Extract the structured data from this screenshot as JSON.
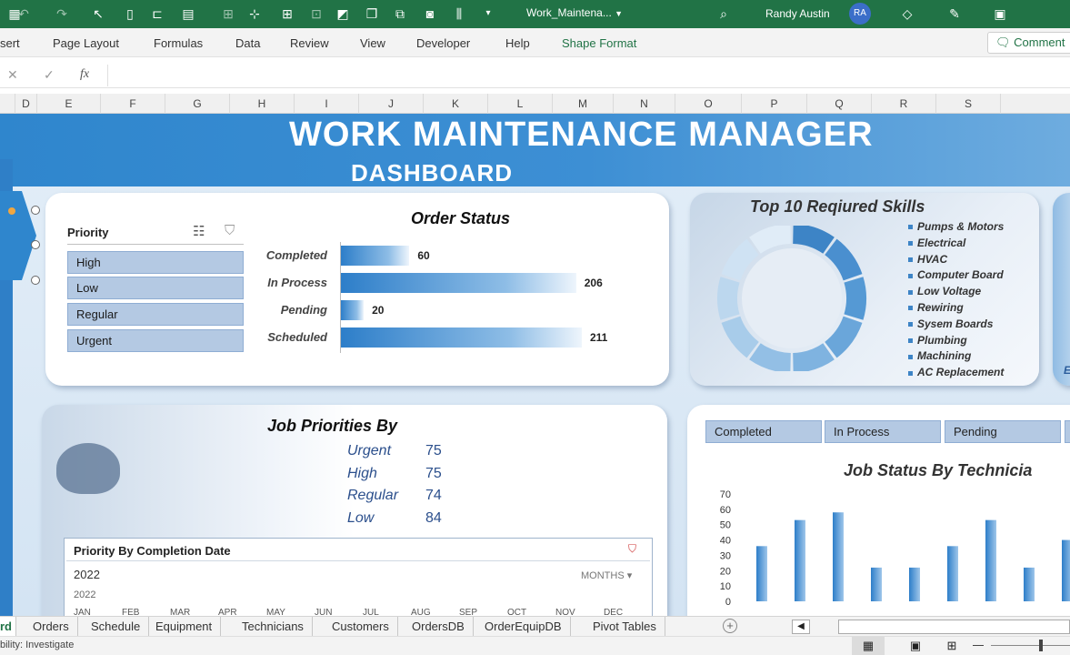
{
  "titlebar": {
    "filename": "Work_Maintena...",
    "user": "Randy Austin",
    "user_initials": "RA"
  },
  "ribbon": {
    "tabs": [
      "sert",
      "Page Layout",
      "Formulas",
      "Data",
      "Review",
      "View",
      "Developer",
      "Help",
      "Shape Format"
    ],
    "comments": "Comment"
  },
  "formula_bar": {
    "fx": "fx",
    "cancel": "✕",
    "enter": "✓"
  },
  "columns": [
    "D",
    "E",
    "F",
    "G",
    "H",
    "I",
    "J",
    "K",
    "L",
    "M",
    "N",
    "O",
    "P",
    "Q",
    "R",
    "S"
  ],
  "dashboard": {
    "title": "WORK MAINTENANCE MANAGER",
    "subtitle": "DASHBOARD"
  },
  "slicer": {
    "title": "Priority",
    "items": [
      "High",
      "Low",
      "Regular",
      "Urgent"
    ]
  },
  "order_status": {
    "title": "Order Status"
  },
  "chart_data": [
    {
      "type": "bar",
      "title": "Order Status",
      "categories": [
        "Completed",
        "In Process",
        "Pending",
        "Scheduled"
      ],
      "values": [
        60,
        206,
        20,
        211
      ]
    },
    {
      "type": "pie",
      "title": "Top 10 Reqiured Skills",
      "categories": [
        "Pumps & Motors",
        "Electrical",
        "HVAC",
        "Computer Board",
        "Low Voltage",
        "Rewiring",
        "Sysem Boards",
        "Plumbing",
        "Machining",
        "AC Replacement"
      ]
    },
    {
      "type": "bar",
      "title": "Job Status By Technicia",
      "ylim": [
        0,
        70
      ],
      "yticks": [
        0,
        10,
        20,
        30,
        40,
        50,
        60,
        70
      ],
      "values": [
        36,
        53,
        58,
        22,
        22,
        36,
        53,
        22,
        40
      ]
    }
  ],
  "skills": {
    "title": "Top 10 Reqiured Skills",
    "items": [
      "Pumps & Motors",
      "Electrical",
      "HVAC",
      "Computer Board",
      "Low Voltage",
      "Rewiring",
      "Sysem Boards",
      "Plumbing",
      "Machining",
      "AC Replacement"
    ],
    "cut_letter": "E"
  },
  "job_priorities": {
    "title": "Job Priorities By",
    "rows": [
      {
        "label": "Urgent",
        "value": "75"
      },
      {
        "label": "High",
        "value": "75"
      },
      {
        "label": "Regular",
        "value": "74"
      },
      {
        "label": "Low",
        "value": "84"
      }
    ]
  },
  "timeline": {
    "title": "Priority By Completion Date",
    "year": "2022",
    "year_small": "2022",
    "period": "MONTHS",
    "months": [
      "JAN",
      "FEB",
      "MAR",
      "APR",
      "MAY",
      "JUN",
      "JUL",
      "AUG",
      "SEP",
      "OCT",
      "NOV",
      "DEC"
    ]
  },
  "tech_filters": [
    "Completed",
    "In Process",
    "Pending"
  ],
  "tech_chart": {
    "title": "Job Status By Technicia"
  },
  "sheet_tabs": [
    "rd",
    "Orders",
    "Schedule",
    "Equipment",
    "Technicians",
    "Customers",
    "OrdersDB",
    "OrderEquipDB",
    "Pivot Tables"
  ],
  "status": {
    "text": "bility: Investigate"
  },
  "colors": {
    "excel_green": "#217346",
    "banner_blue": "#2f86cd",
    "bar_blue": "#3d84c6",
    "slicer_fill": "#b4c9e3"
  }
}
